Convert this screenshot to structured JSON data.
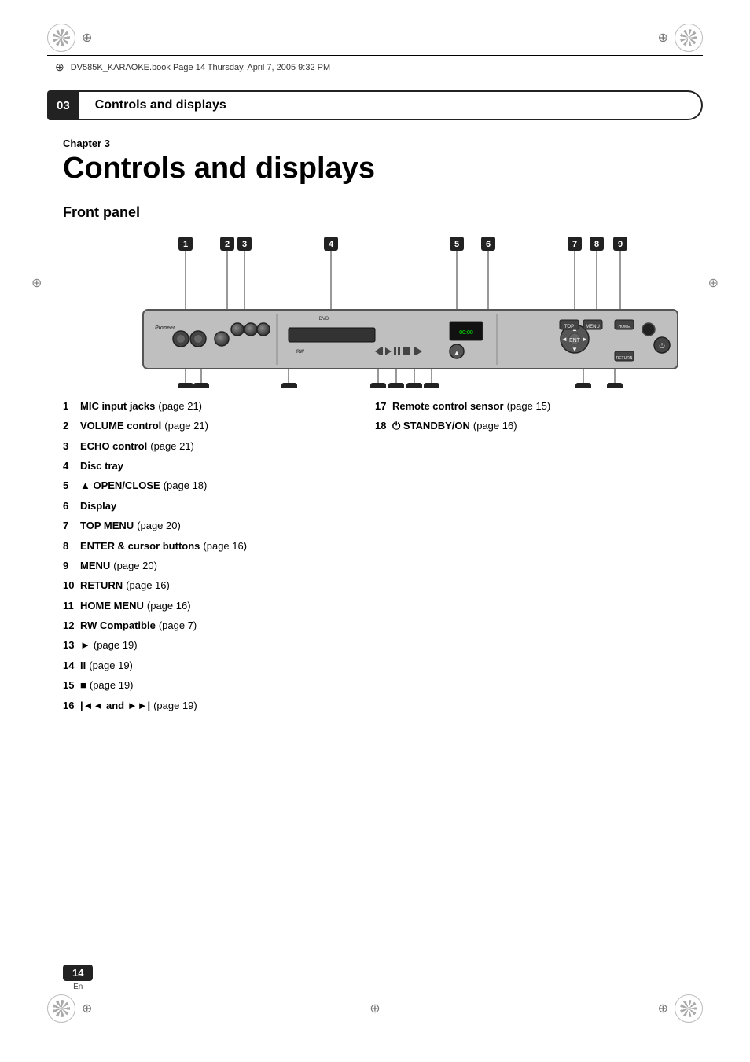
{
  "meta": {
    "file_info": "DV585K_KARAOKE.book  Page 14  Thursday, April 7, 2005  9:32 PM",
    "page_number": "14",
    "page_lang": "En"
  },
  "chapter": {
    "number": "03",
    "label": "Chapter 3",
    "title": "Controls and displays",
    "section": "Front panel"
  },
  "items": [
    {
      "num": "1",
      "label": "MIC input jacks",
      "page": "(page 21)"
    },
    {
      "num": "2",
      "label": "VOLUME control",
      "page": "(page 21)"
    },
    {
      "num": "3",
      "label": "ECHO control",
      "page": "(page 21)"
    },
    {
      "num": "4",
      "label": "Disc tray",
      "page": ""
    },
    {
      "num": "5",
      "label": "▲ OPEN/CLOSE",
      "page": "(page 18)"
    },
    {
      "num": "6",
      "label": "Display",
      "page": ""
    },
    {
      "num": "7",
      "label": "TOP MENU",
      "page": "(page 20)"
    },
    {
      "num": "8",
      "label": "ENTER & cursor buttons",
      "page": "(page 16)"
    },
    {
      "num": "9",
      "label": "MENU",
      "page": "(page 20)"
    },
    {
      "num": "10",
      "label": "RETURN",
      "page": "(page 16)"
    },
    {
      "num": "11",
      "label": "HOME MENU",
      "page": "(page 16)"
    },
    {
      "num": "12",
      "label": "RW Compatible",
      "page": "(page 7)"
    },
    {
      "num": "13",
      "label": "►",
      "page": "(page 19)"
    },
    {
      "num": "14",
      "label": "II",
      "page": "(page 19)"
    },
    {
      "num": "15",
      "label": "■",
      "page": "(page 19)"
    },
    {
      "num": "16",
      "label": "|◄◄ and ►►|",
      "page": "(page 19)"
    },
    {
      "num": "17",
      "label": "Remote control sensor",
      "page": "(page 15)"
    },
    {
      "num": "18",
      "label": "⏻ STANDBY/ON",
      "page": "(page 16)"
    }
  ],
  "items_left": [
    {
      "num": "1",
      "label": "MIC input jacks",
      "page": "(page 21)"
    },
    {
      "num": "2",
      "label": "VOLUME control",
      "page": "(page 21)"
    },
    {
      "num": "3",
      "label": "ECHO control",
      "page": "(page 21)"
    },
    {
      "num": "4",
      "label": "Disc tray",
      "page": ""
    },
    {
      "num": "5",
      "label": "▲ OPEN/CLOSE",
      "page": "(page 18)"
    },
    {
      "num": "6",
      "label": "Display",
      "page": ""
    },
    {
      "num": "7",
      "label": "TOP MENU",
      "page": "(page 20)"
    },
    {
      "num": "8",
      "label": "ENTER & cursor buttons",
      "page": "(page 16)"
    },
    {
      "num": "9",
      "label": "MENU",
      "page": "(page 20)"
    },
    {
      "num": "10",
      "label": "RETURN",
      "page": "(page 16)"
    },
    {
      "num": "11",
      "label": "HOME MENU",
      "page": "(page 16)"
    },
    {
      "num": "12",
      "label": "RW Compatible",
      "page": "(page 7)"
    },
    {
      "num": "13",
      "label": "►",
      "page": "(page 19)"
    },
    {
      "num": "14",
      "label": "II",
      "page": "(page 19)"
    },
    {
      "num": "15",
      "label": "■",
      "page": "(page 19)"
    },
    {
      "num": "16",
      "label": "|◄◄ and ►►|",
      "page": "(page 19)"
    }
  ],
  "items_right": [
    {
      "num": "17",
      "label": "Remote control sensor",
      "page": "(page 15)"
    },
    {
      "num": "18",
      "label": "⏻ STANDBY/ON",
      "page": "(page 16)"
    }
  ]
}
